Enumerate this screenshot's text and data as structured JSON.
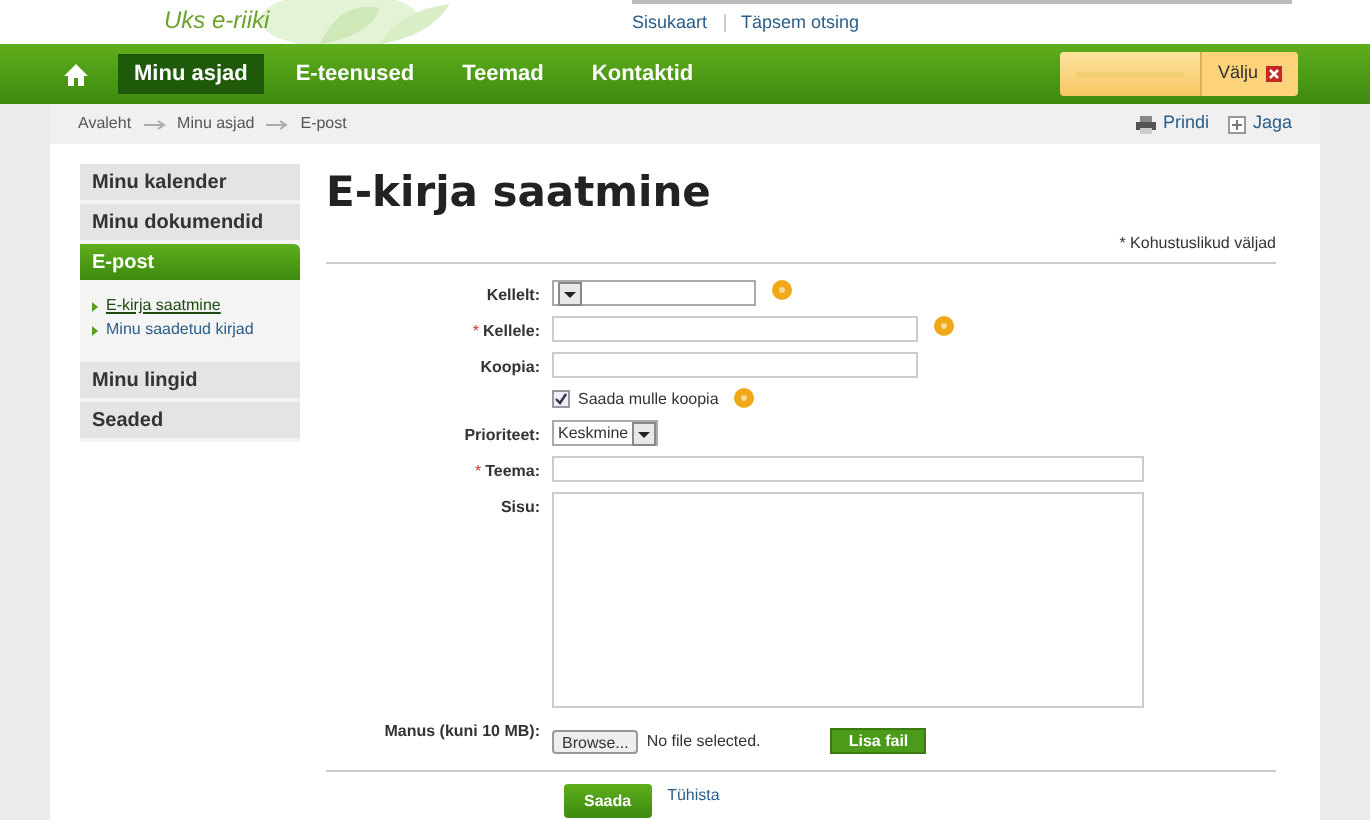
{
  "header": {
    "tagline": "Uks e-riiki",
    "links": [
      "Sisukaart",
      "Täpsem otsing"
    ]
  },
  "nav": {
    "items": [
      {
        "label": "Minu asjad",
        "selected": true
      },
      {
        "label": "E-teenused",
        "selected": false
      },
      {
        "label": "Teemad",
        "selected": false
      },
      {
        "label": "Kontaktid",
        "selected": false
      }
    ],
    "logout": "Välju"
  },
  "breadcrumb": [
    "Avaleht",
    "Minu asjad",
    "E-post"
  ],
  "actions": [
    {
      "kind": "print",
      "label": "Prindi"
    },
    {
      "kind": "share",
      "label": "Jaga"
    }
  ],
  "sidebar": {
    "items": [
      {
        "label": "Minu kalender",
        "selected": false
      },
      {
        "label": "Minu dokumendid",
        "selected": false
      },
      {
        "label": "E-post",
        "selected": true,
        "children": [
          {
            "label": "E-kirja saatmine",
            "selected": true
          },
          {
            "label": "Minu saadetud kirjad",
            "selected": false
          }
        ]
      },
      {
        "label": "Minu lingid",
        "selected": false
      },
      {
        "label": "Seaded",
        "selected": false
      }
    ]
  },
  "page": {
    "title": "E-kirja saatmine",
    "required_note": "* Kohustuslikud väljad"
  },
  "form": [
    {
      "kind": "select",
      "label": "Kellelt:",
      "help": true
    },
    {
      "kind": "text",
      "label": "Kellele:",
      "marker": "*",
      "help": true
    },
    {
      "kind": "text",
      "label": "Koopia:",
      "help": false
    },
    {
      "kind": "checkbox",
      "label": "Saada mulle koopia",
      "checked": true,
      "help": true
    },
    {
      "kind": "select",
      "label": "Prioriteet:",
      "value": "Keskmine",
      "help": false
    },
    {
      "kind": "wide",
      "label": "Teema:",
      "marker": "*",
      "help": false
    },
    {
      "kind": "textarea",
      "label": "Sisu:",
      "help": false
    },
    {
      "kind": "file",
      "label": "Manus (kuni 10 MB):",
      "browse": "Browse...",
      "status": "No file selected.",
      "add": "Lisa fail"
    }
  ],
  "buttons": {
    "submit": "Saada",
    "cancel": "Tühista"
  }
}
